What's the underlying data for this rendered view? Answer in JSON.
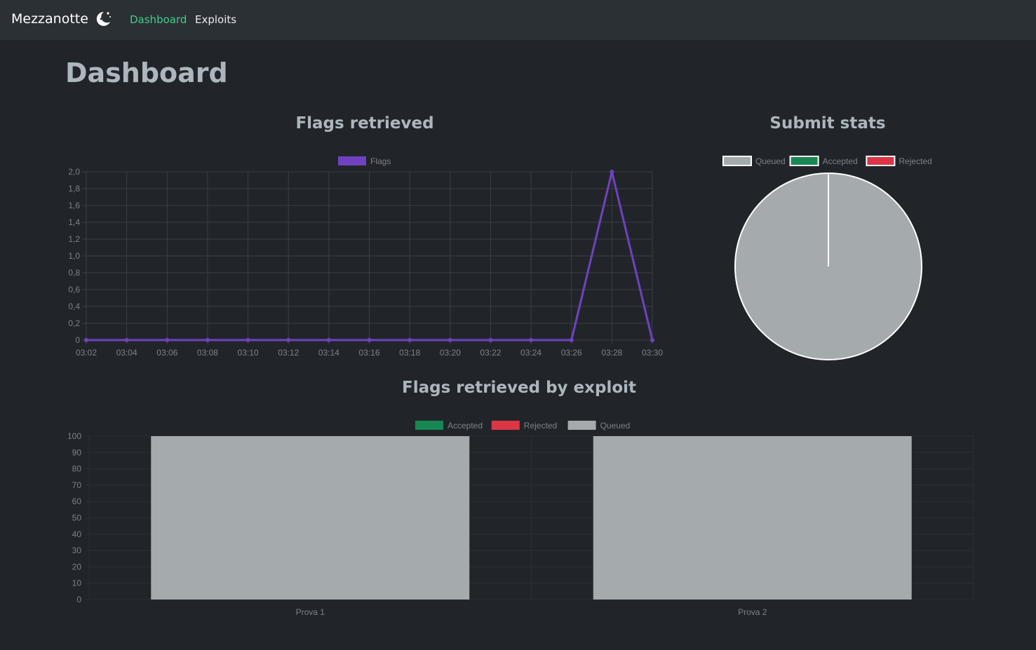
{
  "navbar": {
    "brand": "Mezzanotte",
    "links": [
      {
        "label": "Dashboard",
        "active": true
      },
      {
        "label": "Exploits",
        "active": false
      }
    ]
  },
  "page": {
    "title": "Dashboard"
  },
  "colors": {
    "purple": "#6f42c1",
    "accepted": "#198754",
    "rejected": "#dc3545",
    "queued": "#a5aaad",
    "grid": "#3b3f43",
    "tick": "#7c8287"
  },
  "charts": {
    "flags_title": "Flags retrieved",
    "submit_title": "Submit stats",
    "exploit_title": "Flags retrieved by exploit"
  },
  "chart_data": [
    {
      "type": "line",
      "title": "Flags retrieved",
      "x": [
        "03:02",
        "03:04",
        "03:06",
        "03:08",
        "03:10",
        "03:12",
        "03:14",
        "03:16",
        "03:18",
        "03:20",
        "03:22",
        "03:24",
        "03:26",
        "03:28",
        "03:30"
      ],
      "series": [
        {
          "name": "Flags",
          "values": [
            0,
            0,
            0,
            0,
            0,
            0,
            0,
            0,
            0,
            0,
            0,
            0,
            0,
            2,
            0
          ]
        }
      ],
      "ylim": [
        0,
        2
      ],
      "yticks": [
        "0",
        "0,2",
        "0,4",
        "0,6",
        "0,8",
        "1,0",
        "1,2",
        "1,4",
        "1,6",
        "1,8",
        "2,0"
      ],
      "legend": "top",
      "grid": true
    },
    {
      "type": "pie",
      "title": "Submit stats",
      "labels": [
        "Queued",
        "Accepted",
        "Rejected"
      ],
      "values": [
        100,
        0,
        0
      ],
      "legend": "top"
    },
    {
      "type": "bar",
      "title": "Flags retrieved by exploit",
      "categories": [
        "Prova 1",
        "Prova 2"
      ],
      "series": [
        {
          "name": "Accepted",
          "values": [
            0,
            0
          ]
        },
        {
          "name": "Rejected",
          "values": [
            0,
            0
          ]
        },
        {
          "name": "Queued",
          "values": [
            100,
            100
          ]
        }
      ],
      "ylim": [
        0,
        100
      ],
      "yticks": [
        "0",
        "10",
        "20",
        "30",
        "40",
        "50",
        "60",
        "70",
        "80",
        "90",
        "100"
      ],
      "stacked": true,
      "legend": "top",
      "grid": true
    }
  ]
}
